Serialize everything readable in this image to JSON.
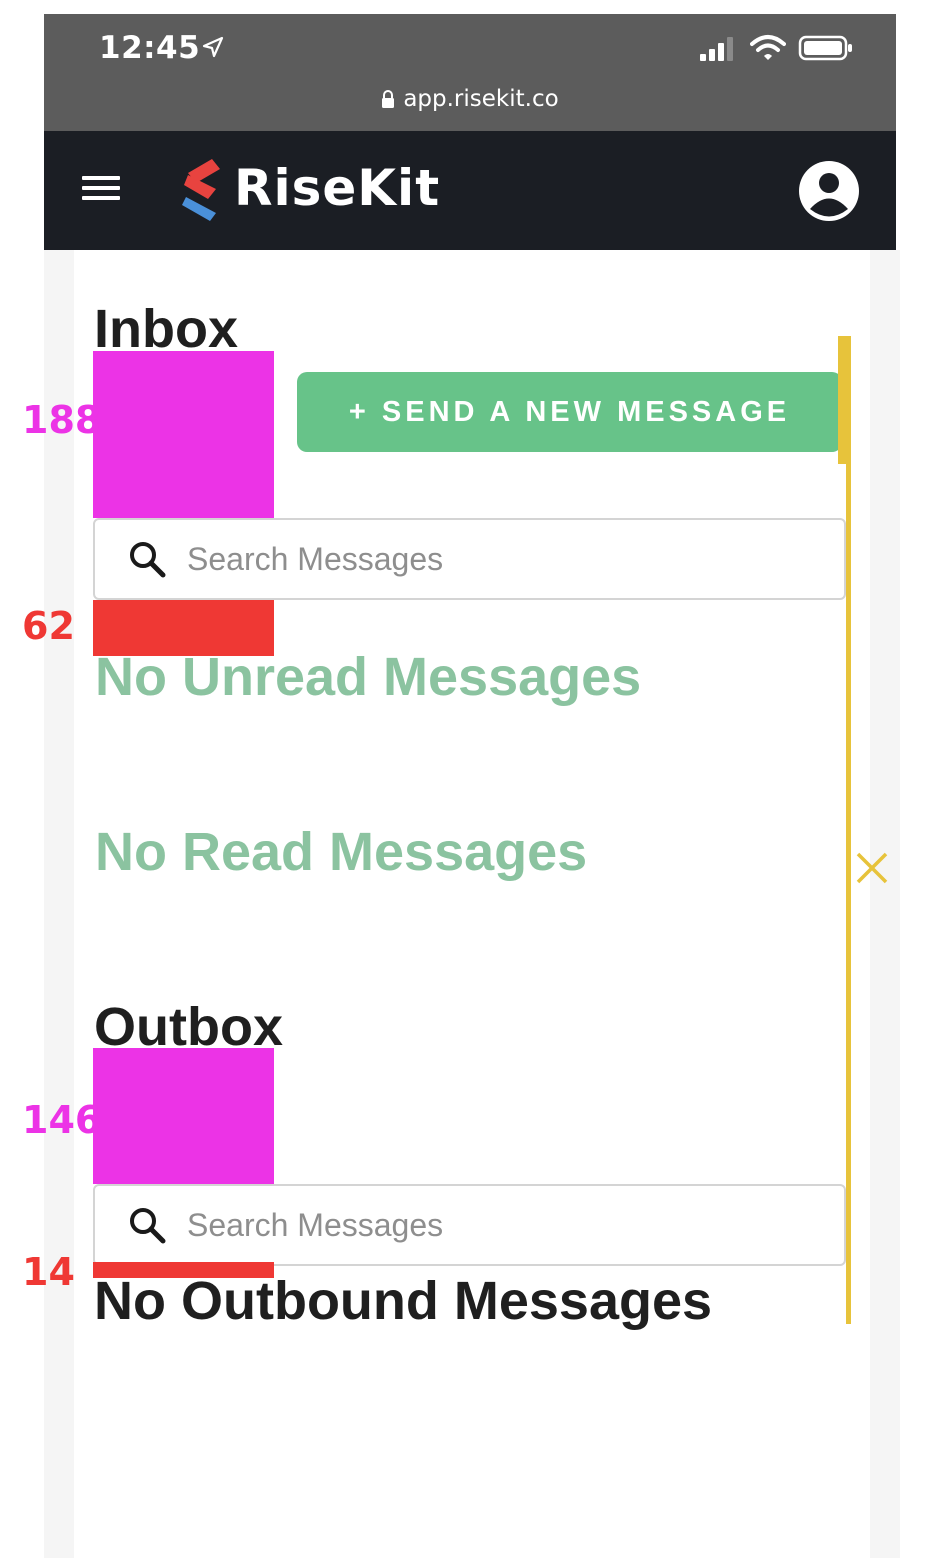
{
  "status_bar": {
    "time": "12:45",
    "url": "app.risekit.co"
  },
  "header": {
    "brand": "RiseKit",
    "menu_icon": "hamburger-icon",
    "profile_icon": "user-circle-icon"
  },
  "inbox": {
    "title": "Inbox",
    "send_button_label": "+ SEND A NEW MESSAGE",
    "search_placeholder": "Search Messages",
    "unread_empty": "No Unread Messages",
    "read_empty": "No Read Messages"
  },
  "outbox": {
    "title": "Outbox",
    "search_placeholder": "Search Messages",
    "empty": "No Outbound Messages"
  },
  "measurements": {
    "inbox_spacer": "188",
    "inbox_gap": "62",
    "outbox_spacer": "146",
    "outbox_gap": "14"
  },
  "colors": {
    "header_bg": "#1b1e24",
    "status_bg": "#5c5c5c",
    "button_green": "#67c389",
    "empty_green": "#8bc3a0",
    "spacer_magenta": "#ec33e6",
    "spacer_red": "#ef3834",
    "guide_yellow": "#e7c33b"
  }
}
